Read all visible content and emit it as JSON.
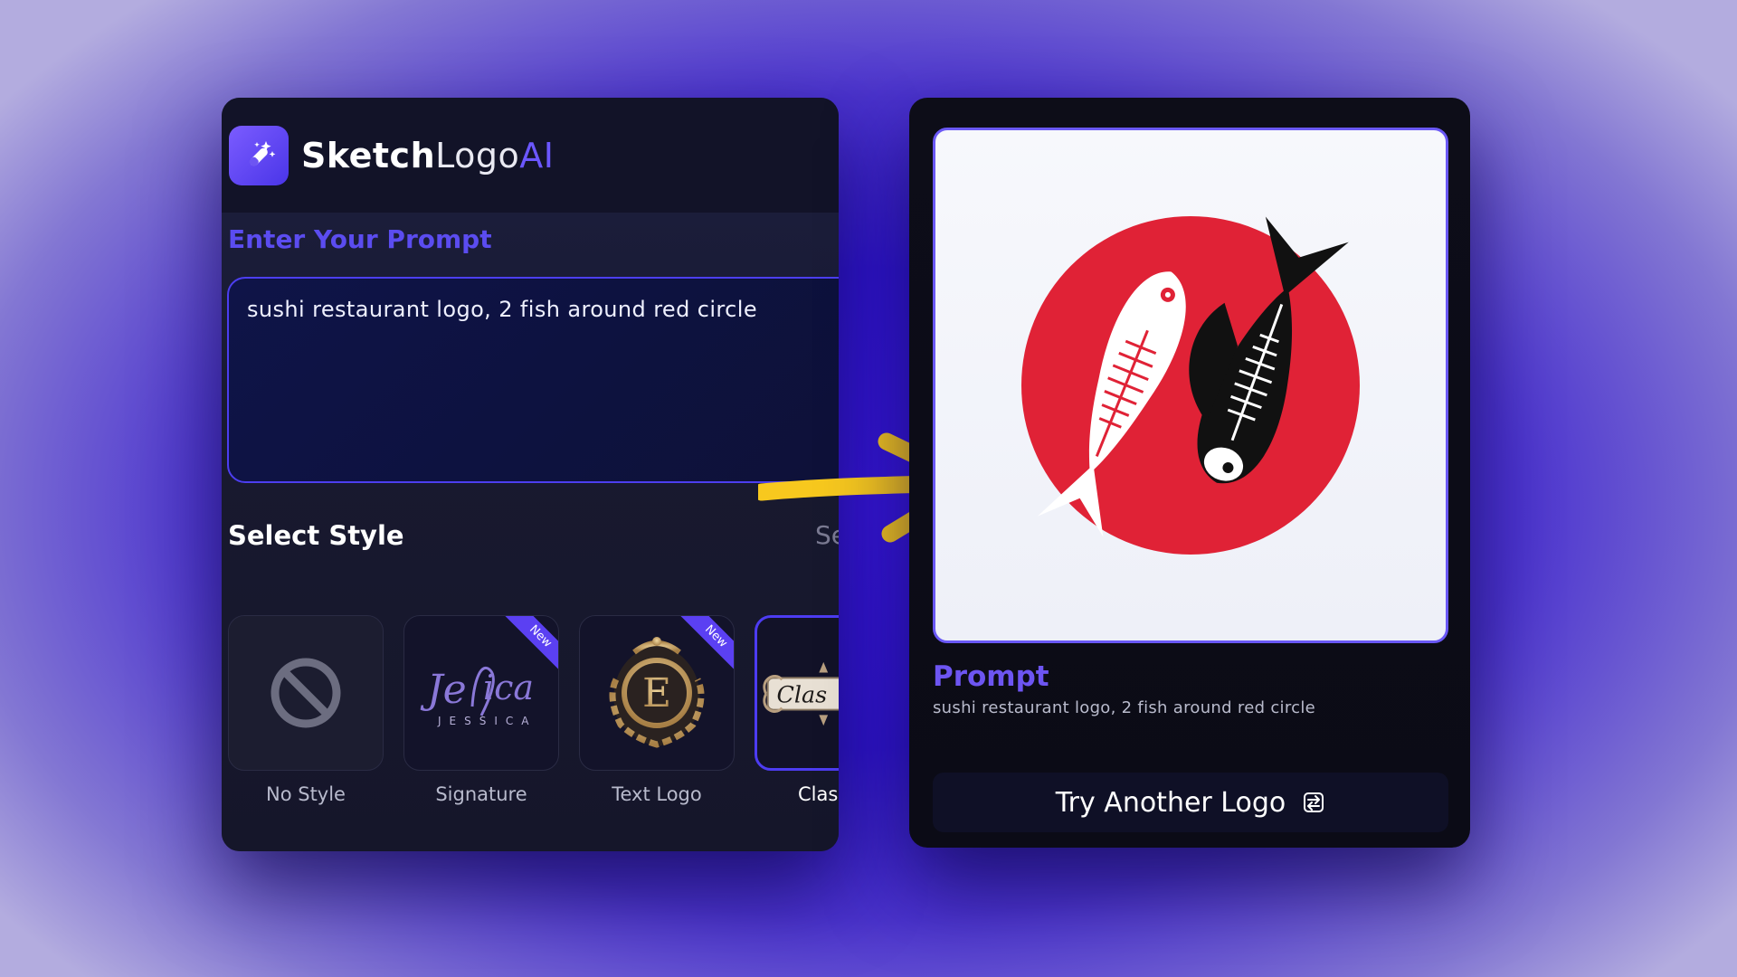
{
  "app": {
    "brand_part1": "Sketch",
    "brand_part2": "Logo",
    "brand_part3": "AI",
    "icon": "magic-wand-icon"
  },
  "prompt_section": {
    "label": "Enter Your Prompt",
    "value": "sushi restaurant logo, 2 fish around red circle"
  },
  "style_section": {
    "title": "Select Style",
    "see_all": "Se",
    "items": [
      {
        "label": "No Style",
        "icon": "no-style-icon",
        "badge": ""
      },
      {
        "label": "Signature",
        "badge": "New",
        "sample_text": "JESSICA"
      },
      {
        "label": "Text Logo",
        "badge": "New",
        "sample_text": "E"
      },
      {
        "label": "Clas",
        "badge": "",
        "sample_text": "Clas",
        "selected": true
      }
    ]
  },
  "result": {
    "title": "Prompt",
    "prompt": "sushi restaurant logo, 2 fish around red circle",
    "button_label": "Try Another Logo",
    "button_icon": "swap-icon"
  },
  "colors": {
    "accent": "#5b4cf0",
    "arrow": "#f7c81e",
    "logo_red": "#e02236"
  }
}
